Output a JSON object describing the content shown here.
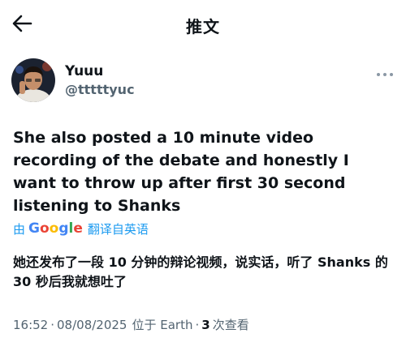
{
  "header": {
    "back_icon": "arrow-left-icon",
    "title": "推文"
  },
  "author": {
    "name": "Yuuu",
    "handle": "@tttttyuc",
    "avatar_icon": "avatar-photo",
    "more_icon": "more-dots-icon"
  },
  "tweet": {
    "text": "She also posted a 10 minute video recording of the debate and honestly I want to throw up after first 30 second listening to Shanks"
  },
  "translation": {
    "by_label": "由",
    "provider": "Google",
    "link_label": "翻译自英语",
    "text": "她还发布了一段 10 分钟的辩论视频，说实话，听了 Shanks 的 30 秒后我就想吐了"
  },
  "meta": {
    "time": "16:52",
    "date": "08/08/2025",
    "location": "位于 Earth",
    "views_count": "3",
    "views_label": "次查看"
  },
  "colors": {
    "link_blue": "#1d9bf0",
    "text_primary": "#0f1419",
    "text_secondary": "#536471"
  }
}
